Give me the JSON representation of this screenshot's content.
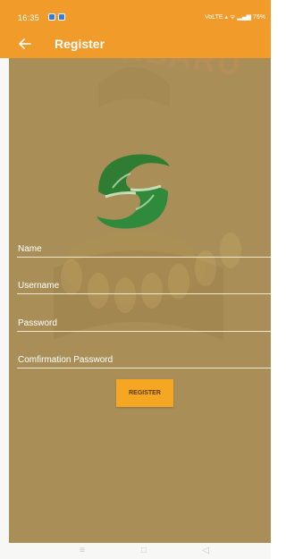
{
  "status_bar": {
    "time": "16:35",
    "right": "VoLTE ▴ ᯤ ▂▄▆ 76%"
  },
  "app_bar": {
    "title": "Register",
    "back_icon": "arrow-left-icon"
  },
  "background": {
    "watermark_text": "PEKANBARU"
  },
  "form": {
    "fields": [
      {
        "label": "Name"
      },
      {
        "label": "Username"
      },
      {
        "label": "Password"
      },
      {
        "label": "Comfirmation Password"
      }
    ],
    "submit_label": "REGISTER"
  },
  "nav_bar": {
    "menu_icon": "≡",
    "home_icon": "□",
    "back_icon": "◁"
  },
  "colors": {
    "accent": "#f19b2a",
    "background": "#a98f57",
    "logo_green": "#2e7d32",
    "button": "#f5a623"
  }
}
